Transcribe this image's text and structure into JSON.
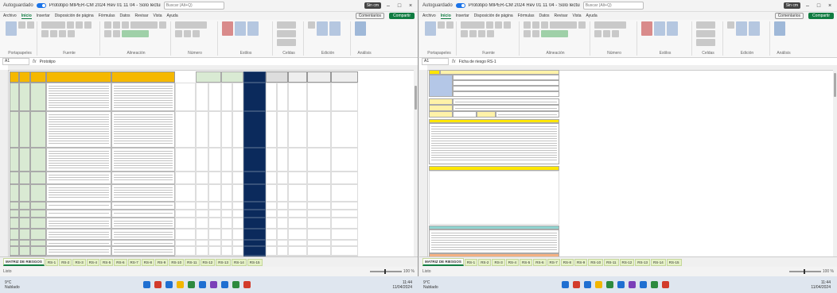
{
  "left_window": {
    "autosave": "Autoguardado",
    "title": "Prototipo MIPER-CM 2024 Rev 01 11 04 - Solo lectura",
    "search": "Buscar (Alt+Q)",
    "badge": "Sin cm",
    "menu": [
      "Archivo",
      "Inicio",
      "Insertar",
      "Disposición de página",
      "Fórmulas",
      "Datos",
      "Revisar",
      "Vista",
      "Ayuda"
    ],
    "comments": "Comentarios",
    "share": "Compartir",
    "ribbon_groups": [
      "Portapapeles",
      "Fuente",
      "Alineación",
      "Número",
      "Estilos",
      "Celdas",
      "Edición",
      "Análisis"
    ],
    "namebox": "A1",
    "formula": "Prototipo",
    "tabs": [
      "MATRIZ DE RIESGOS",
      "RS-1",
      "RS-2",
      "RS-3",
      "RS-4",
      "RS-5",
      "RS-6",
      "RS-7",
      "RS-8",
      "RS-9",
      "RS-10",
      "RS-11",
      "RS-12",
      "RS-13",
      "RS-14",
      "RS-15"
    ],
    "status": "Listo",
    "zoom": "100 %"
  },
  "right_window": {
    "autosave": "Autoguardado",
    "title": "Prototipo MIPER-CM 2024 Rev 01 11 04 - Solo lectura",
    "search": "Buscar (Alt+Q)",
    "badge": "Sin cm",
    "menu": [
      "Archivo",
      "Inicio",
      "Insertar",
      "Disposición de página",
      "Fórmulas",
      "Datos",
      "Revisar",
      "Vista",
      "Ayuda"
    ],
    "comments": "Comentarios",
    "share": "Compartir",
    "ribbon_groups": [
      "Portapapeles",
      "Fuente",
      "Alineación",
      "Número",
      "Estilos",
      "Celdas",
      "Edición",
      "Análisis"
    ],
    "namebox": "A1",
    "formula": "Ficha de riesgo RS-1",
    "tabs": [
      "MATRIZ DE RIESGOS",
      "RS-1",
      "RS-2",
      "RS-3",
      "RS-4",
      "RS-5",
      "RS-6",
      "RS-7",
      "RS-8",
      "RS-9",
      "RS-10",
      "RS-11",
      "RS-12",
      "RS-13",
      "RS-14",
      "RS-15"
    ],
    "status": "Listo",
    "zoom": "100 %"
  },
  "taskbar": {
    "weather_left": [
      "9°C",
      "Nublado"
    ],
    "weather_right": [
      "9°C",
      "Nublado"
    ],
    "time_left": [
      "11:44",
      "11/04/2024"
    ],
    "time_right": [
      "11:44",
      "11/04/2024"
    ],
    "icon_colors": [
      "#1f6fd1",
      "#d23b2b",
      "#1f6fd1",
      "#f2b600",
      "#2d8a3e",
      "#1f6fd1",
      "#7b3fb8",
      "#1f6fd1",
      "#2d8a3e",
      "#d23b2b"
    ]
  }
}
